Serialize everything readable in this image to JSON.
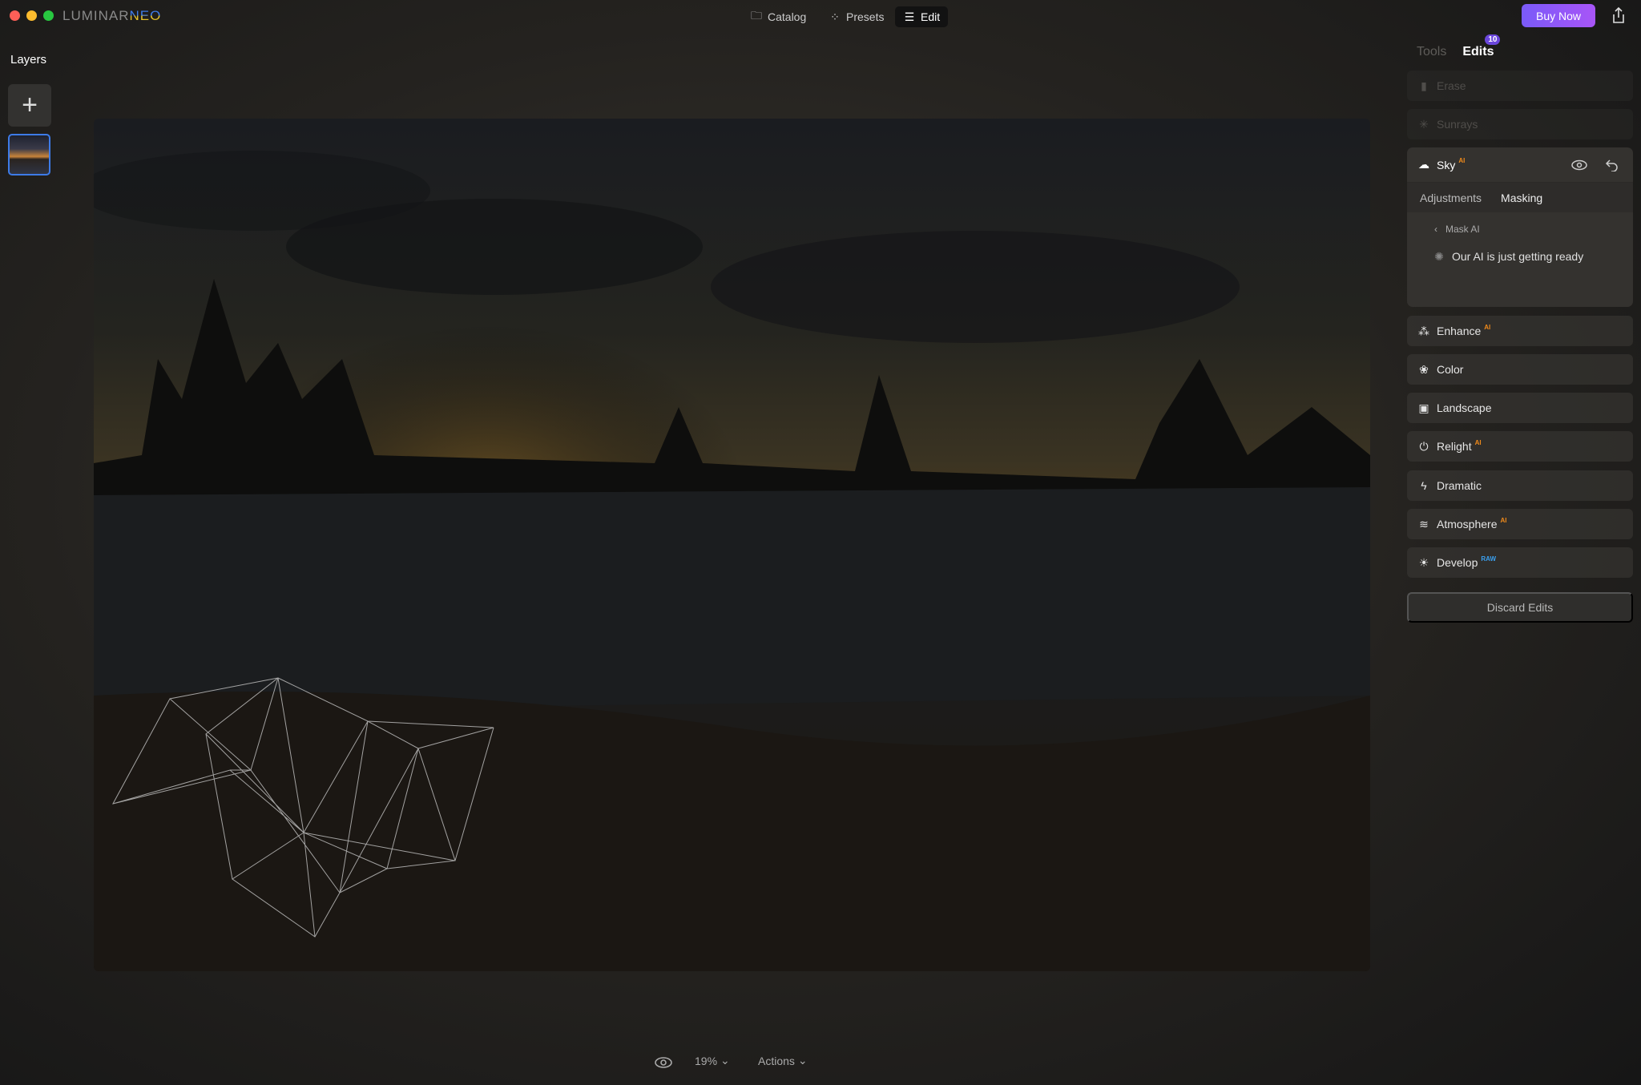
{
  "app": {
    "logo_main": "LUMINAR",
    "logo_accent": "NEO"
  },
  "nav": [
    {
      "label": "Catalog",
      "icon": "folder-icon"
    },
    {
      "label": "Presets",
      "icon": "sparkle-icon"
    },
    {
      "label": "Edit",
      "icon": "sliders-icon",
      "active": true
    }
  ],
  "buy_now": "Buy Now",
  "layers": {
    "title": "Layers"
  },
  "panel": {
    "tabs": {
      "tools": "Tools",
      "edits": "Edits",
      "edits_count": "10"
    },
    "disabled_items": [
      {
        "label": "Erase",
        "icon": "eraser-icon"
      },
      {
        "label": "Sunrays",
        "icon": "sunrays-icon"
      }
    ],
    "sky": {
      "label": "Sky",
      "badge": "AI",
      "tabs": [
        "Adjustments",
        "Masking"
      ],
      "active_tab": "Masking",
      "back_label": "Mask AI",
      "status": "Our AI is just getting ready"
    },
    "items": [
      {
        "label": "Enhance",
        "badge": "AI",
        "icon": "enhance-icon"
      },
      {
        "label": "Color",
        "badge": "",
        "icon": "color-icon"
      },
      {
        "label": "Landscape",
        "badge": "",
        "icon": "landscape-icon"
      },
      {
        "label": "Relight",
        "badge": "AI",
        "icon": "relight-icon"
      },
      {
        "label": "Dramatic",
        "badge": "",
        "icon": "lightning-icon"
      },
      {
        "label": "Atmosphere",
        "badge": "AI",
        "icon": "atmosphere-icon"
      },
      {
        "label": "Develop",
        "badge": "RAW",
        "icon": "develop-icon"
      }
    ],
    "discard": "Discard Edits"
  },
  "bottom": {
    "zoom": "19%",
    "actions": "Actions"
  },
  "colors": {
    "accent": "#7a5af8",
    "ai_badge": "#f08a1a",
    "raw_badge": "#3aa0f0",
    "selection": "#3d7be8"
  }
}
